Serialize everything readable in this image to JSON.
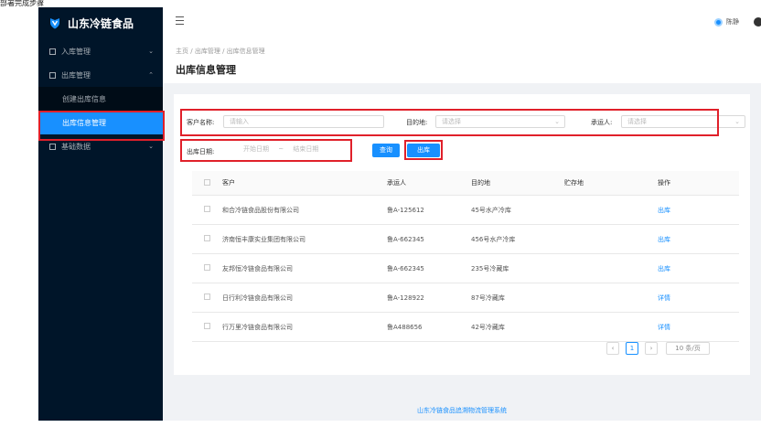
{
  "caption": "部署完成步骤",
  "app": {
    "title": "山东冷链食品"
  },
  "sidebar": {
    "items": [
      {
        "label": "入库管理"
      },
      {
        "label": "出库管理"
      },
      {
        "label": "创建出库信息"
      },
      {
        "label": "出库信息管理"
      },
      {
        "label": "基础数据"
      }
    ]
  },
  "header": {
    "user_name": "陈静"
  },
  "breadcrumb": {
    "home": "主页",
    "sep": "/",
    "level1": "出库管理",
    "level2": "出库信息管理"
  },
  "page": {
    "title": "出库信息管理"
  },
  "filters": {
    "customer_label": "客户名称:",
    "customer_placeholder": "请输入",
    "destination_label": "目的地:",
    "destination_placeholder": "请选择",
    "carrier_label": "承运人:",
    "carrier_placeholder": "请选择",
    "date_label": "出库日期:",
    "start_placeholder": "开始日期",
    "range_sep": "~",
    "end_placeholder": "结束日期",
    "query_label": "查询",
    "outbound_label": "出库"
  },
  "table": {
    "columns": [
      "客户",
      "承运人",
      "目的地",
      "贮存地",
      "操作"
    ],
    "rows": [
      {
        "customer": "和合冷链食品股份有限公司",
        "carrier": "鲁A-125612",
        "destination": "45号水产冷库",
        "storage": "",
        "action": "出库"
      },
      {
        "customer": "济南恒丰康实业集团有限公司",
        "carrier": "鲁A-662345",
        "destination": "456号水产冷库",
        "storage": "",
        "action": "出库"
      },
      {
        "customer": "友邦恒冷链食品有限公司",
        "carrier": "鲁A-662345",
        "destination": "235号冷藏库",
        "storage": "",
        "action": "出库"
      },
      {
        "customer": "日行利冷链食品有限公司",
        "carrier": "鲁A-128922",
        "destination": "87号冷藏库",
        "storage": "",
        "action": "详情"
      },
      {
        "customer": "行万里冷链食品有限公司",
        "carrier": "鲁A488656",
        "destination": "42号冷藏库",
        "storage": "",
        "action": "详情"
      }
    ]
  },
  "pagination": {
    "prev": "‹",
    "page": "1",
    "next": "›",
    "page_size": "10 条/页"
  },
  "footer": {
    "text": "山东冷链食品追溯物流管理系统"
  },
  "colors": {
    "sidebar": "#001529",
    "primary": "#1890ff",
    "highlight": "#e0202a"
  }
}
